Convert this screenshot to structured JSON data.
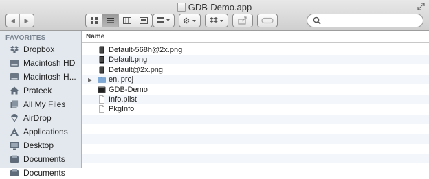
{
  "window": {
    "title": "GDB-Demo.app"
  },
  "toolbar": {
    "back": "◀",
    "forward": "▶",
    "view_icons": "icon-view",
    "view_list": "list-view",
    "view_columns": "column-view",
    "view_coverflow": "coverflow-view",
    "arrange": "arrange-menu",
    "action": "action-menu",
    "dropbox": "dropbox-menu",
    "share": "share",
    "tags": "tags"
  },
  "search": {
    "placeholder": ""
  },
  "sidebar": {
    "heading": "FAVORITES",
    "items": [
      {
        "label": "Dropbox",
        "icon": "dropbox-icon"
      },
      {
        "label": "Macintosh HD",
        "icon": "hard-drive-icon"
      },
      {
        "label": "Macintosh H...",
        "icon": "hard-drive-icon"
      },
      {
        "label": "Prateek",
        "icon": "home-icon"
      },
      {
        "label": "All My Files",
        "icon": "all-files-icon"
      },
      {
        "label": "AirDrop",
        "icon": "airdrop-icon"
      },
      {
        "label": "Applications",
        "icon": "applications-icon"
      },
      {
        "label": "Desktop",
        "icon": "desktop-icon"
      },
      {
        "label": "Documents",
        "icon": "documents-icon"
      },
      {
        "label": "Documents",
        "icon": "documents-icon"
      }
    ]
  },
  "content": {
    "column_header": "Name",
    "files": [
      {
        "name": "Default-568h@2x.png",
        "icon": "phone-image-icon",
        "folder": false
      },
      {
        "name": "Default.png",
        "icon": "phone-image-icon",
        "folder": false
      },
      {
        "name": "Default@2x.png",
        "icon": "phone-image-icon",
        "folder": false
      },
      {
        "name": "en.lproj",
        "icon": "folder-icon",
        "folder": true
      },
      {
        "name": "GDB-Demo",
        "icon": "executable-icon",
        "folder": false
      },
      {
        "name": "Info.plist",
        "icon": "document-icon",
        "folder": false
      },
      {
        "name": "PkgInfo",
        "icon": "document-icon",
        "folder": false
      }
    ]
  },
  "colors": {
    "sidebar_bg": "#e3e8ee",
    "alt_row": "#f3f6fa",
    "folder_blue": "#7fa9d6"
  }
}
